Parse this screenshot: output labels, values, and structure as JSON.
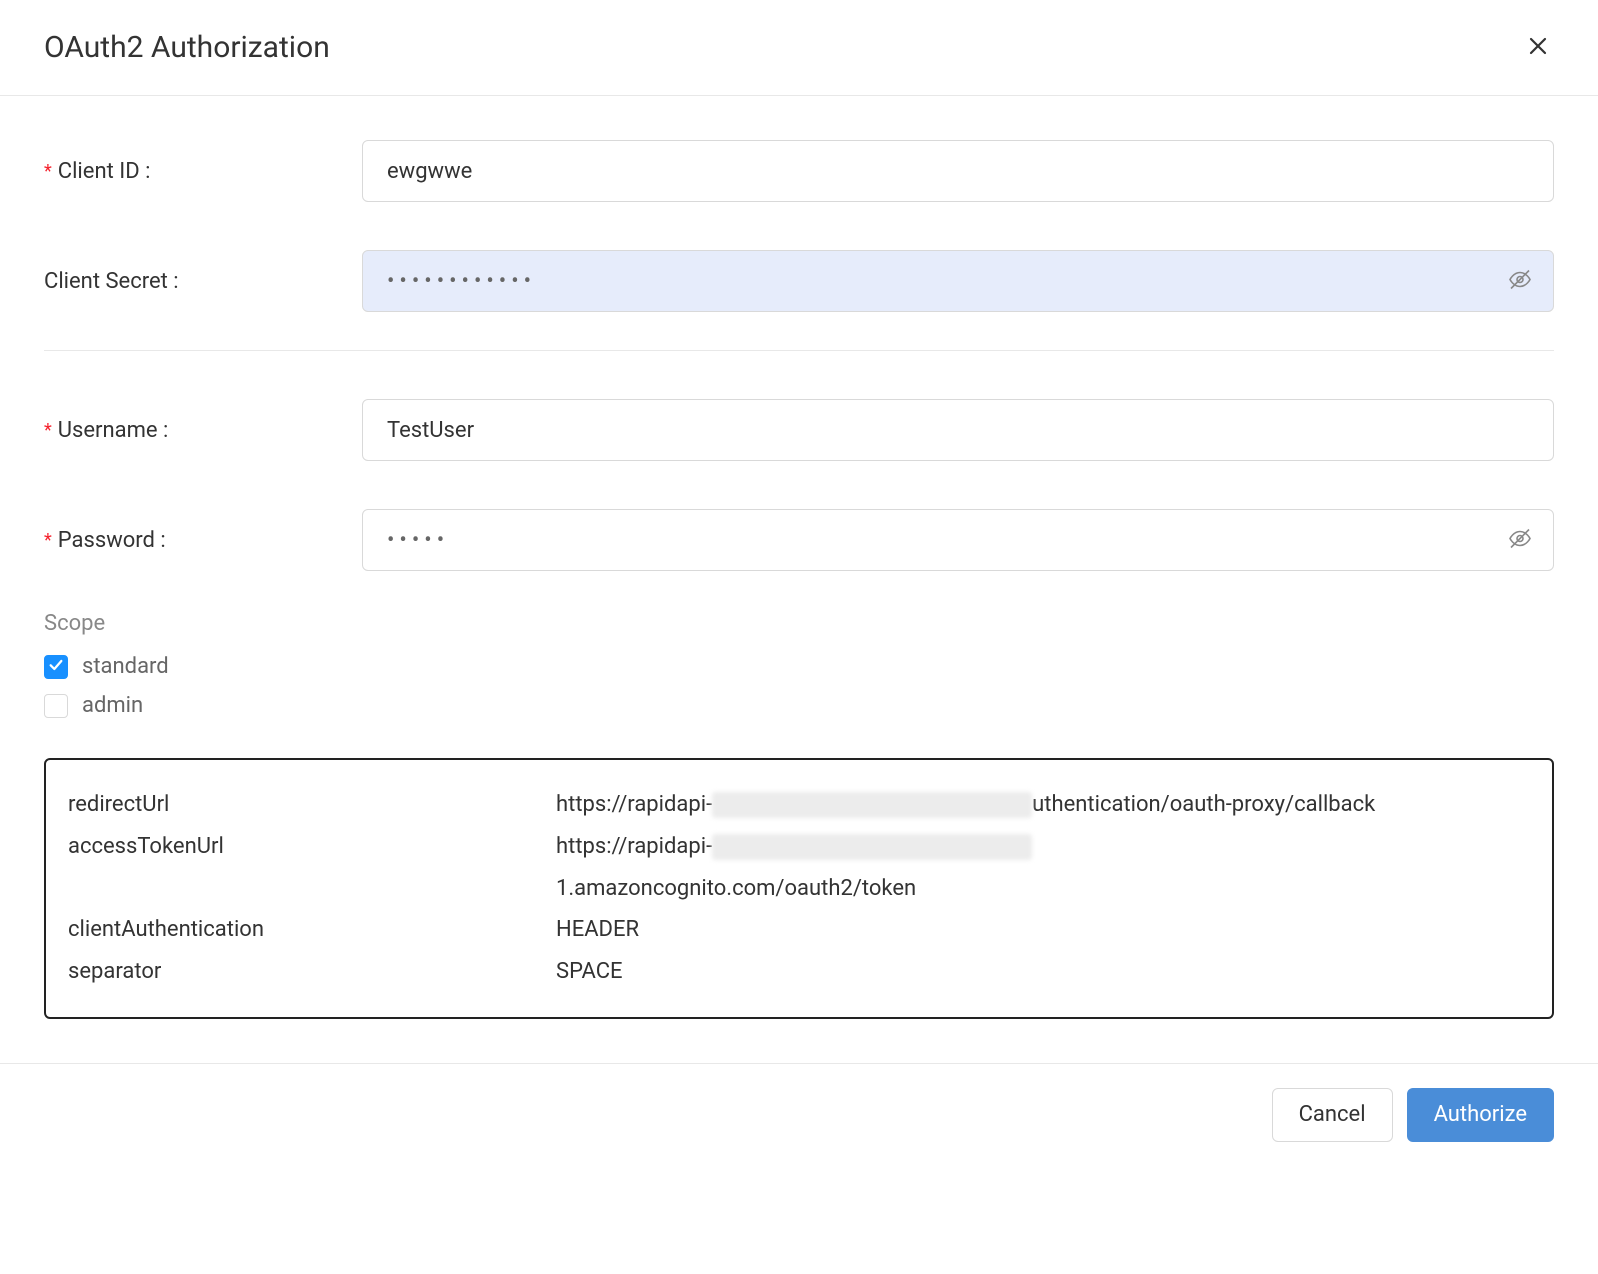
{
  "header": {
    "title": "OAuth2 Authorization"
  },
  "fields": {
    "clientId": {
      "label": "Client ID :",
      "required": true,
      "value": "ewgwwe"
    },
    "clientSecret": {
      "label": "Client Secret :",
      "required": false,
      "value": "••••••••••••",
      "selected": true
    },
    "username": {
      "label": "Username :",
      "required": true,
      "value": "TestUser"
    },
    "password": {
      "label": "Password :",
      "required": true,
      "value": "•••••"
    }
  },
  "scope": {
    "label": "Scope",
    "options": [
      {
        "label": "standard",
        "checked": true
      },
      {
        "label": "admin",
        "checked": false
      }
    ]
  },
  "details": {
    "redirectUrl": {
      "key": "redirectUrl",
      "prefix": "https://rapidapi-",
      "suffix": "uthentication/oauth-proxy/callback"
    },
    "accessTokenUrl": {
      "key": "accessTokenUrl",
      "prefix": "https://rapidapi-",
      "line2": "1.amazoncognito.com/oauth2/token"
    },
    "clientAuthentication": {
      "key": "clientAuthentication",
      "value": "HEADER"
    },
    "separator": {
      "key": "separator",
      "value": "SPACE"
    }
  },
  "footer": {
    "cancel": "Cancel",
    "authorize": "Authorize"
  }
}
